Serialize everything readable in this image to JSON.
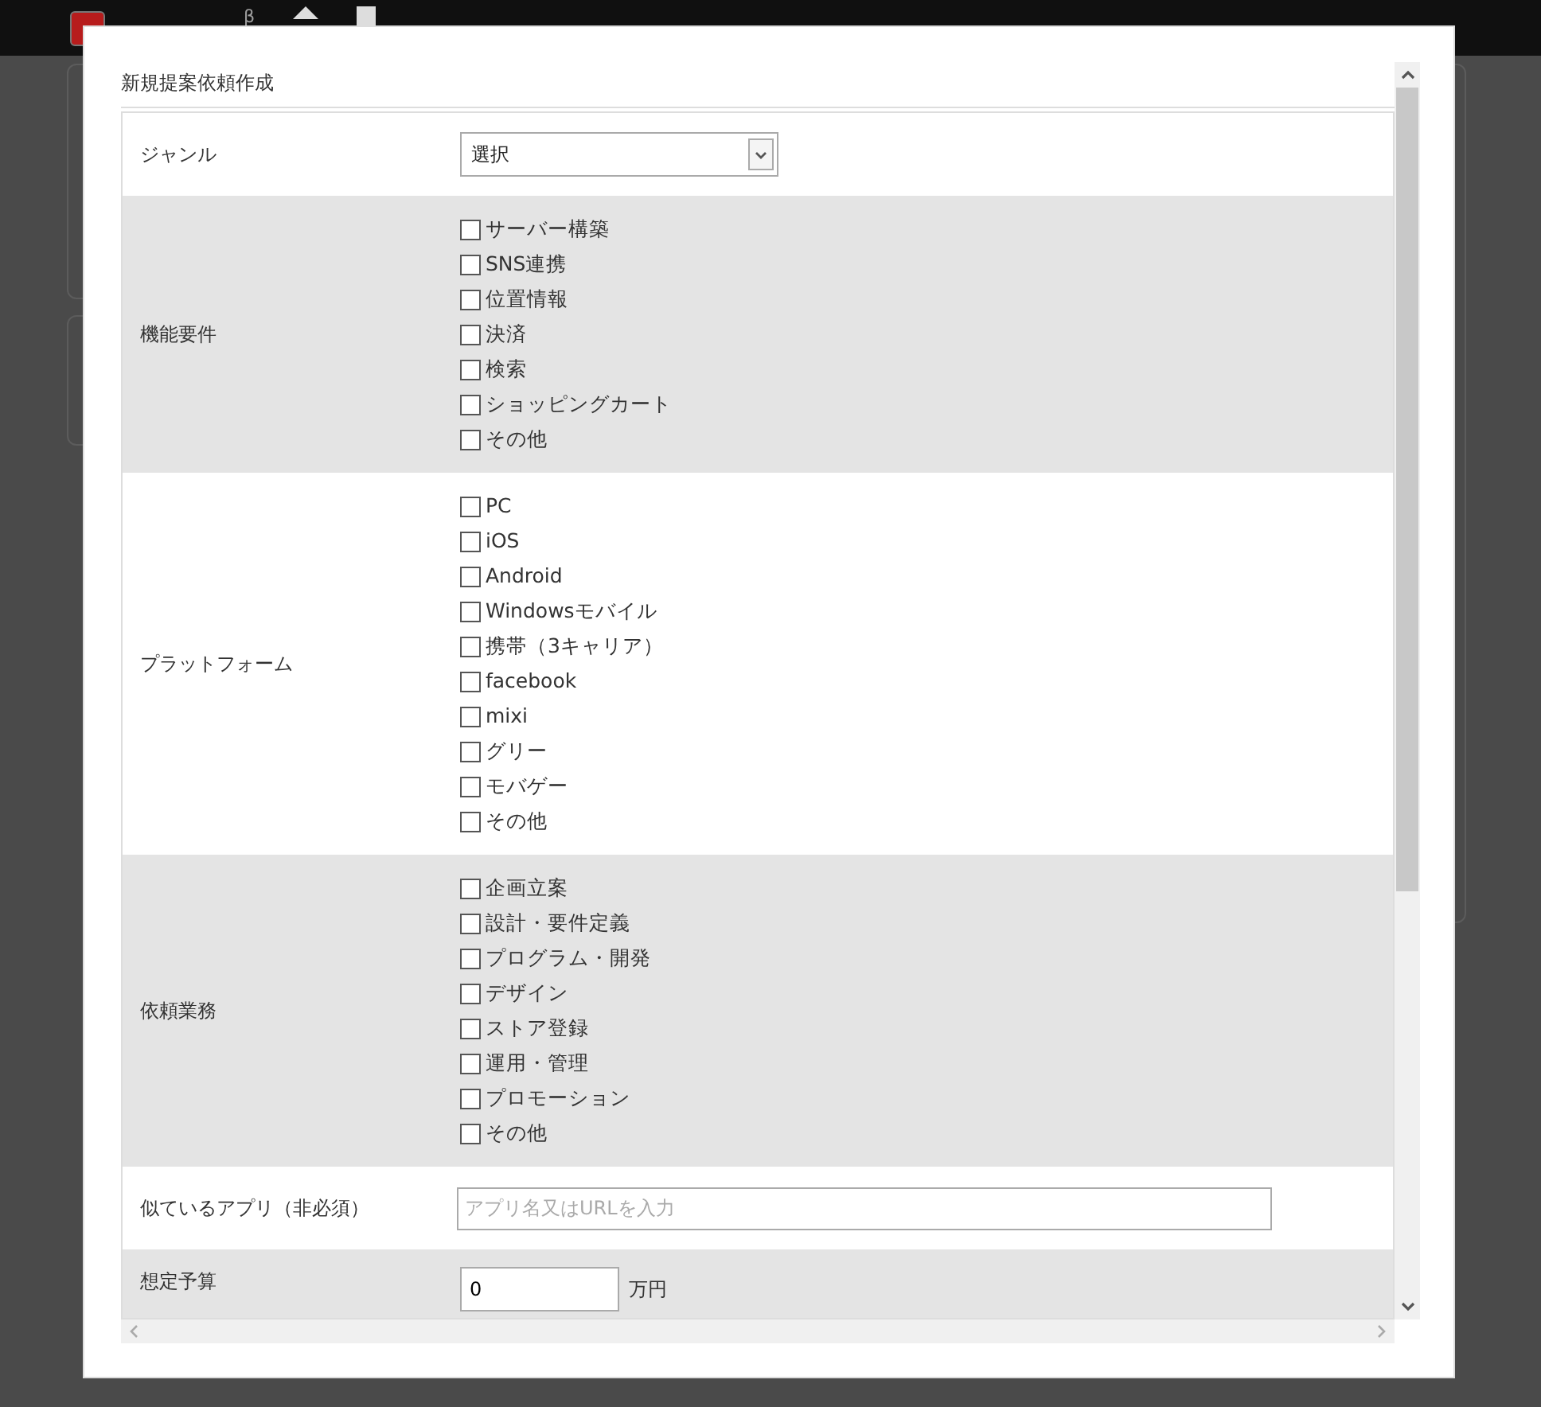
{
  "header": {
    "logo_mark": "β"
  },
  "modal": {
    "title": "新規提案依頼作成",
    "rows": [
      {
        "kind": "select",
        "label": "ジャンル",
        "value": "選択"
      },
      {
        "kind": "checkboxes",
        "label": "機能要件",
        "options": [
          {
            "label": "サーバー構築",
            "checked": false
          },
          {
            "label": "SNS連携",
            "checked": false
          },
          {
            "label": "位置情報",
            "checked": false
          },
          {
            "label": "決済",
            "checked": false
          },
          {
            "label": "検索",
            "checked": false
          },
          {
            "label": "ショッピングカート",
            "checked": false
          },
          {
            "label": "その他",
            "checked": false
          }
        ]
      },
      {
        "kind": "checkboxes",
        "label": "プラットフォーム",
        "options": [
          {
            "label": "PC",
            "checked": false
          },
          {
            "label": "iOS",
            "checked": false
          },
          {
            "label": "Android",
            "checked": false
          },
          {
            "label": "Windowsモバイル",
            "checked": false
          },
          {
            "label": "携帯（3キャリア）",
            "checked": false
          },
          {
            "label": "facebook",
            "checked": false
          },
          {
            "label": "mixi",
            "checked": false
          },
          {
            "label": "グリー",
            "checked": false
          },
          {
            "label": "モバゲー",
            "checked": false
          },
          {
            "label": "その他",
            "checked": false
          }
        ]
      },
      {
        "kind": "checkboxes",
        "label": "依頼業務",
        "options": [
          {
            "label": "企画立案",
            "checked": false
          },
          {
            "label": "設計・要件定義",
            "checked": false
          },
          {
            "label": "プログラム・開発",
            "checked": false
          },
          {
            "label": "デザイン",
            "checked": false
          },
          {
            "label": "ストア登録",
            "checked": false
          },
          {
            "label": "運用・管理",
            "checked": false
          },
          {
            "label": "プロモーション",
            "checked": false
          },
          {
            "label": "その他",
            "checked": false
          }
        ]
      },
      {
        "kind": "text",
        "label": "似ているアプリ（非必須）",
        "placeholder": "アプリ名又はURLを入力"
      },
      {
        "kind": "number",
        "label": "想定予算",
        "value": "0",
        "unit": "万円"
      }
    ]
  }
}
